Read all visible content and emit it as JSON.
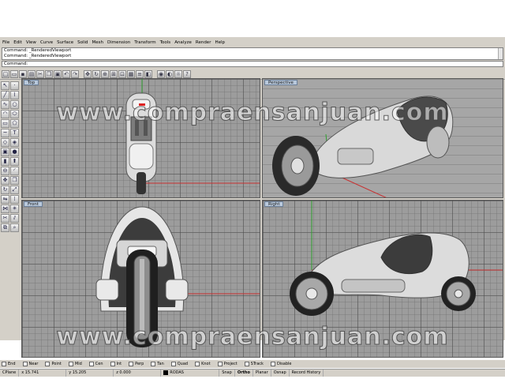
{
  "menu": [
    "File",
    "Edit",
    "View",
    "Curve",
    "Surface",
    "Solid",
    "Mesh",
    "Dimension",
    "Transform",
    "Tools",
    "Analyze",
    "Render",
    "Help"
  ],
  "command_history": [
    "Command: _RenderedViewport",
    "Command: _RenderedViewport"
  ],
  "command_prompt": "Command:",
  "viewports": {
    "top": "Top",
    "perspective": "Perspective",
    "front": "Front",
    "right": "Right"
  },
  "osnaps": [
    "End",
    "Near",
    "Point",
    "Mid",
    "Cen",
    "Int",
    "Perp",
    "Tan",
    "Quad",
    "Knot",
    "Project",
    "STrack",
    "Disable"
  ],
  "status": {
    "cplane": "CPlane",
    "x": "x 15.741",
    "y": "y 15.205",
    "z": "z 0.000",
    "layer": "RODAS",
    "snap": "Snap",
    "ortho": "Ortho",
    "planar": "Planar",
    "osnap": "Osnap",
    "record": "Record History"
  },
  "watermark": "www.compraensanjuan.com",
  "colors": {
    "viewport_bg": "#9c9c9c",
    "x_axis": "#c83030",
    "y_axis": "#30a030",
    "active_tag": "#b9c9dc"
  },
  "toolbar_icons": [
    "new-icon",
    "open-icon",
    "save-icon",
    "print-icon",
    "cut-icon",
    "copy-icon",
    "paste-icon",
    "undo-icon",
    "redo-icon",
    "pan-icon",
    "rotate-icon",
    "zoom-icon",
    "zoom-window-icon",
    "zoom-extents-icon",
    "grid-icon",
    "layer-icon",
    "properties-icon",
    "render-icon",
    "shade-icon",
    "light-icon",
    "help-icon"
  ],
  "left_tool_icons": [
    "select-icon",
    "point-icon",
    "line-icon",
    "polyline-icon",
    "curve-icon",
    "circle-icon",
    "arc-icon",
    "ellipse-icon",
    "rectangle-icon",
    "polygon-icon",
    "freeform-icon",
    "text-icon",
    "surface-icon",
    "loft-icon",
    "box-icon",
    "sphere-icon",
    "cylinder-icon",
    "extrude-icon",
    "boolean-icon",
    "fillet-icon",
    "move-icon",
    "copy-icon",
    "rotate-icon",
    "scale-icon",
    "mirror-icon",
    "array-icon",
    "join-icon",
    "explode-icon",
    "trim-icon",
    "split-icon",
    "group-icon",
    "analyze-icon"
  ]
}
